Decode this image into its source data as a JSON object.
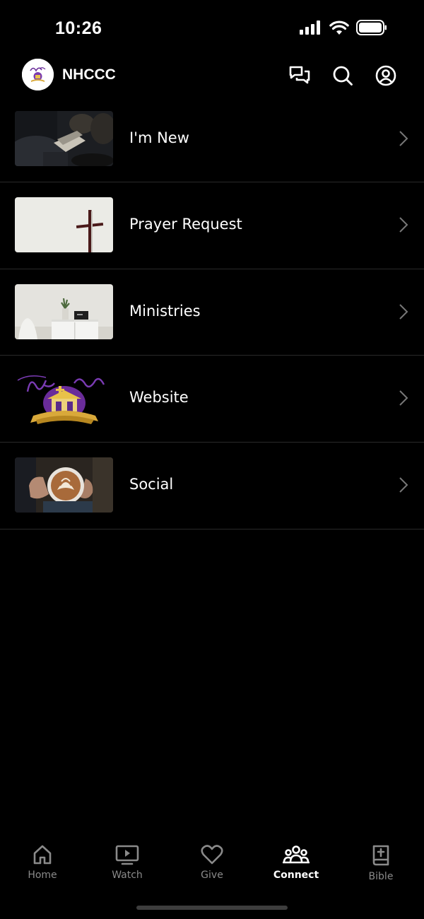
{
  "status": {
    "time": "10:26"
  },
  "header": {
    "title": "NHCCC"
  },
  "list": [
    {
      "label": "I'm New",
      "thumb": "people-sitting-photo"
    },
    {
      "label": "Prayer Request",
      "thumb": "cross-photo"
    },
    {
      "label": "Ministries",
      "thumb": "room-plant-photo"
    },
    {
      "label": "Website",
      "thumb": "new-hope-logo"
    },
    {
      "label": "Social",
      "thumb": "coffee-cup-photo"
    }
  ],
  "tabs": [
    {
      "label": "Home",
      "icon": "home-icon",
      "active": false
    },
    {
      "label": "Watch",
      "icon": "tv-play-icon",
      "active": false
    },
    {
      "label": "Give",
      "icon": "heart-icon",
      "active": false
    },
    {
      "label": "Connect",
      "icon": "people-icon",
      "active": true
    },
    {
      "label": "Bible",
      "icon": "book-cross-icon",
      "active": false
    }
  ],
  "colors": {
    "background": "#000000",
    "text": "#ffffff",
    "inactive_tab": "#8a8a8a",
    "accent_purple": "#6a2c9a",
    "accent_gold": "#d9a93a"
  }
}
